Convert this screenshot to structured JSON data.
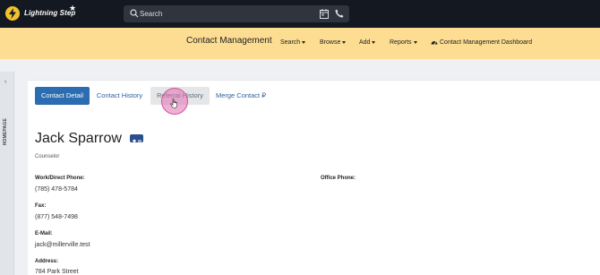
{
  "app": {
    "brand": "Lightning Step",
    "search_placeholder": "Search"
  },
  "nav": {
    "title": "Contact Management",
    "items": [
      {
        "label": "Search"
      },
      {
        "label": "Browse"
      },
      {
        "label": "Add"
      },
      {
        "label": "Reports"
      }
    ],
    "dashboard_label": "Contact Management Dashboard"
  },
  "sidebar": {
    "label": "HOMEPAGE"
  },
  "tabs": [
    {
      "label": "Contact Detail",
      "state": "active"
    },
    {
      "label": "Contact History",
      "state": "normal"
    },
    {
      "label": "Referral History",
      "state": "hover"
    },
    {
      "label": "Merge Contact",
      "state": "normal"
    }
  ],
  "contact": {
    "name": "Jack Sparrow",
    "role": "Counselor",
    "fields": {
      "work_phone_label": "Work/Direct Phone:",
      "work_phone": "(785) 478-5784",
      "office_phone_label": "Office Phone:",
      "fax_label": "Fax:",
      "fax": "(877) 548-7498",
      "email_label": "E-Mail:",
      "email": "jack@millerville.test",
      "address_label": "Address:",
      "address": "784 Park Street"
    }
  },
  "colors": {
    "topbar": "#141820",
    "navbar": "#fddd92",
    "accent": "#2c6cb0",
    "logo": "#f2c12e"
  }
}
